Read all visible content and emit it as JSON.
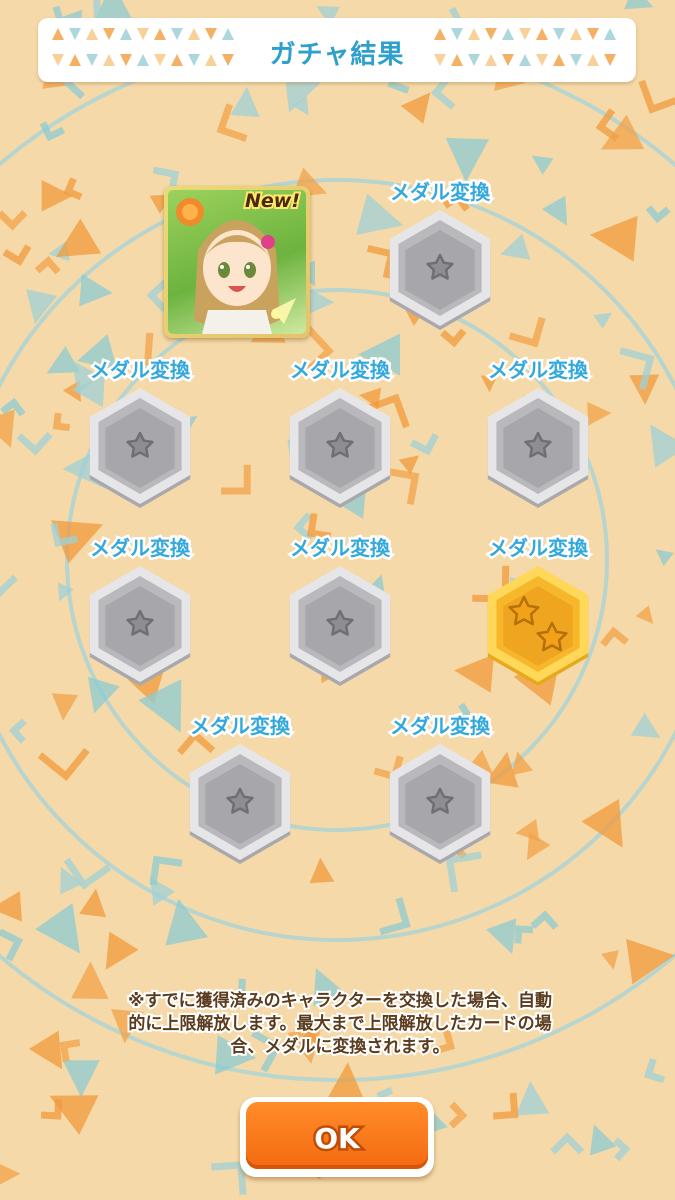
{
  "header": {
    "title": "ガチャ結果"
  },
  "card": {
    "badge": "New!"
  },
  "slots": [
    {
      "label": "メダル変換",
      "medal": "silver-medal",
      "stars": 1
    },
    {
      "label": "メダル変換",
      "medal": "silver-medal",
      "stars": 1
    },
    {
      "label": "メダル変換",
      "medal": "silver-medal",
      "stars": 1
    },
    {
      "label": "メダル変換",
      "medal": "silver-medal",
      "stars": 1
    },
    {
      "label": "メダル変換",
      "medal": "silver-medal",
      "stars": 1
    },
    {
      "label": "メダル変換",
      "medal": "silver-medal",
      "stars": 1
    },
    {
      "label": "メダル変換",
      "medal": "gold-medal",
      "stars": 2
    },
    {
      "label": "メダル変換",
      "medal": "silver-medal",
      "stars": 1
    },
    {
      "label": "メダル変換",
      "medal": "silver-medal",
      "stars": 1
    }
  ],
  "notice": {
    "line1": "※すでに獲得済みのキャラクターを交換した場合、自動",
    "line2": "的に上限解放します。最大まで上限解放したカードの場",
    "line3": "合、メダルに変換されます。"
  },
  "ok_button": {
    "label": "OK"
  },
  "colors": {
    "accent_blue": "#33a8dd",
    "ok_orange": "#f46a10",
    "background": "#f5d9a8"
  }
}
